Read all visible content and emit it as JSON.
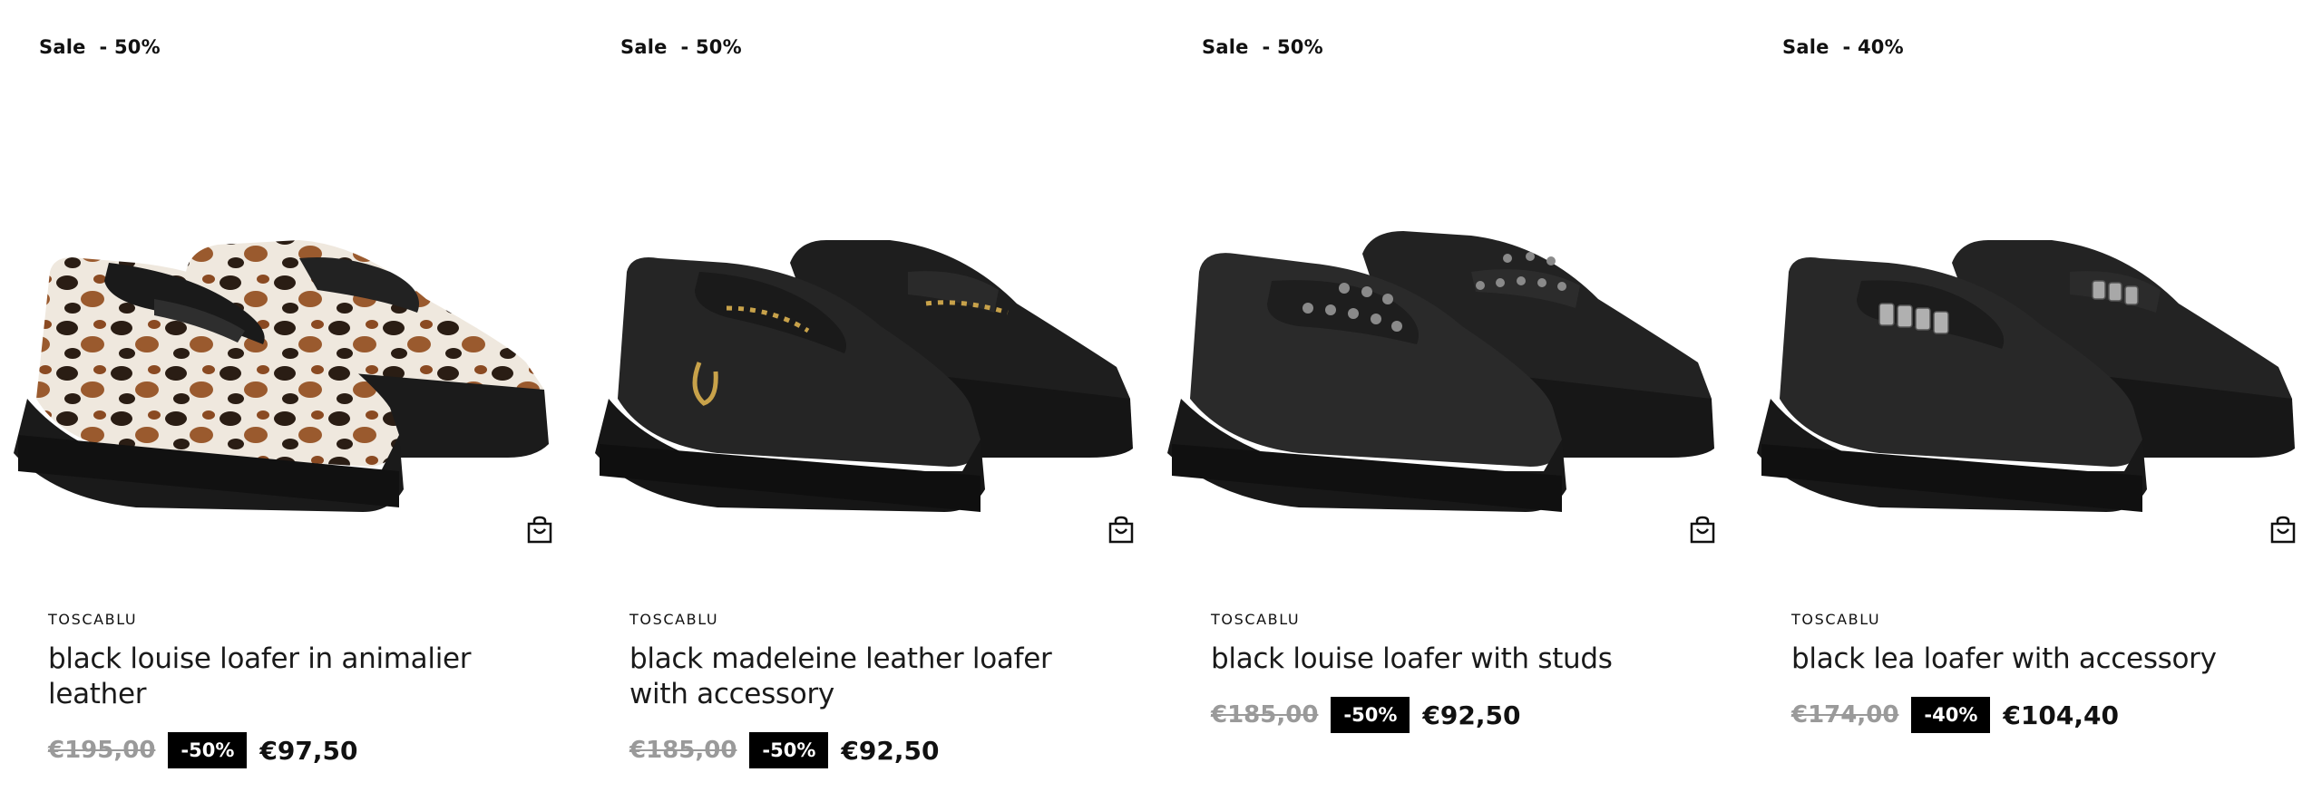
{
  "products": [
    {
      "sale_label": "Sale  - 50%",
      "brand": "TOSCABLU",
      "name": "black louise loafer in animalier leather",
      "old_price": "€195,00",
      "discount": "-50%",
      "price": "€97,50",
      "image_icon": "animalier-loafer-image",
      "cart_icon": "shopping-bag-icon"
    },
    {
      "sale_label": "Sale  - 50%",
      "brand": "TOSCABLU",
      "name": "black madeleine leather loafer with accessory",
      "old_price": "€185,00",
      "discount": "-50%",
      "price": "€92,50",
      "image_icon": "buckle-loafer-image",
      "cart_icon": "shopping-bag-icon"
    },
    {
      "sale_label": "Sale  - 50%",
      "brand": "TOSCABLU",
      "name": "black louise loafer with studs",
      "old_price": "€185,00",
      "discount": "-50%",
      "price": "€92,50",
      "image_icon": "studded-loafer-image",
      "cart_icon": "shopping-bag-icon"
    },
    {
      "sale_label": "Sale  - 40%",
      "brand": "TOSCABLU",
      "name": "black lea loafer with accessory",
      "old_price": "€174,00",
      "discount": "-40%",
      "price": "€104,40",
      "image_icon": "chain-loafer-image",
      "cart_icon": "shopping-bag-icon"
    }
  ],
  "colors": {
    "badge_bg": "#000000",
    "old_price": "#9a9a9a",
    "text": "#111111"
  }
}
